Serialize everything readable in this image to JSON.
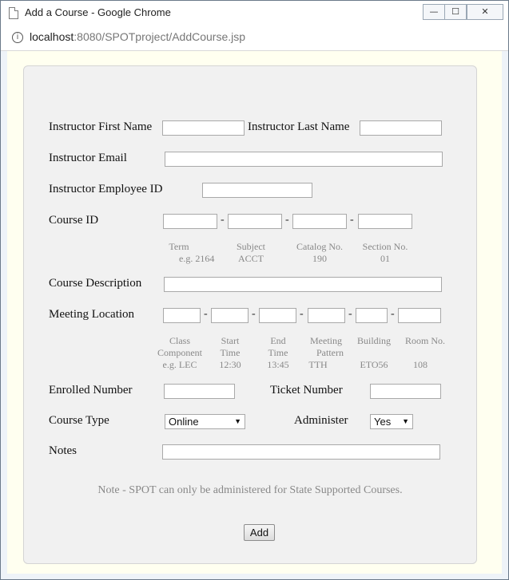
{
  "window": {
    "title": "Add a Course - Google Chrome",
    "buttons": {
      "minimize": "—",
      "maximize": "☐",
      "close": "✕"
    }
  },
  "address": {
    "host": "localhost",
    "rest": ":8080/SPOTproject/AddCourse.jsp",
    "icon": "info-icon"
  },
  "form": {
    "first_name_label": "Instructor First Name",
    "last_name_label": "Instructor Last Name",
    "email_label": "Instructor Email",
    "employee_id_label": "Instructor Employee ID",
    "course_id_label": "Course ID",
    "course_id_hints": [
      {
        "title": "Term",
        "example": "e.g. 2164"
      },
      {
        "title": "Subject",
        "example": "ACCT"
      },
      {
        "title": "Catalog No.",
        "example": "190"
      },
      {
        "title": "Section No.",
        "example": "01"
      }
    ],
    "course_description_label": "Course Description",
    "meeting_location_label": "Meeting Location",
    "meeting_hints": [
      {
        "line1": "Class",
        "line2": "Component",
        "example": "e.g. LEC"
      },
      {
        "line1": "Start",
        "line2": "Time",
        "example": "12:30"
      },
      {
        "line1": "End",
        "line2": "Time",
        "example": "13:45"
      },
      {
        "line1": "Meeting",
        "line2": "Pattern",
        "example": "TTH"
      },
      {
        "line1": "Building",
        "line2": "",
        "example": "ETO56"
      },
      {
        "line1": "Room No.",
        "line2": "",
        "example": "108"
      }
    ],
    "enrolled_label": "Enrolled Number",
    "ticket_label": "Ticket Number",
    "course_type_label": "Course Type",
    "course_type_value": "Online",
    "administer_label": "Administer",
    "administer_value": "Yes",
    "notes_label": "Notes",
    "note_text": "Note - SPOT can only be administered for State Supported Courses.",
    "add_button": "Add",
    "dash": "-"
  }
}
